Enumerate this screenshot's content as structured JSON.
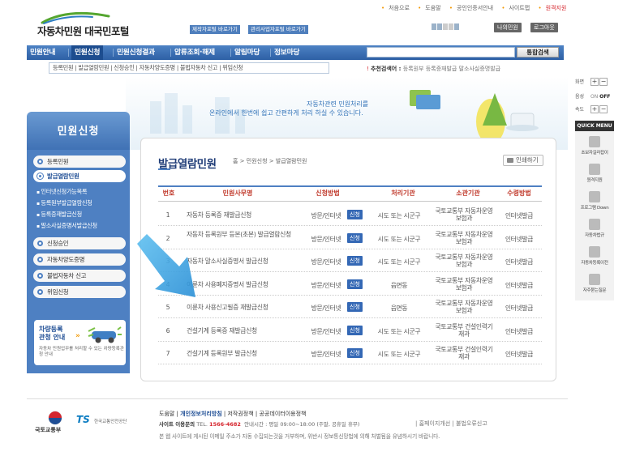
{
  "header": {
    "logo_text": "자동차민원 대국민포털",
    "link_buttons": [
      "제작자포털 바로가기",
      "관리사업자포털 바로가기"
    ],
    "util_links": [
      "처음으로",
      "도움말",
      "공인인증서안내",
      "사이트맵",
      "원격지원"
    ],
    "my_civil_button": "나의민원",
    "logout_button": "로그아웃"
  },
  "nav": {
    "items": [
      "민원안내",
      "민원신청",
      "민원신청결과",
      "압류조회·해제",
      "알림마당",
      "정보마당"
    ],
    "active_index": 1,
    "search_button": "통합검색",
    "search_value": ""
  },
  "subnav": {
    "text": "등록민원 | 발급열람민원 | 신청승인 | 자동차양도증명 | 불법자동차 신고 | 위임신청"
  },
  "recommended": {
    "label": "추천검색어 :",
    "terms": "등록원부  등록증재발급  말소사실증명발급"
  },
  "banner": {
    "line1": "자동차관련 민원처리를",
    "line2": "온라인에서 한번에 쉽고 간편하게 처리 하실 수 있습니다."
  },
  "left_menu": {
    "title": "민원신청",
    "items": [
      {
        "label": "등록민원"
      },
      {
        "label": "발급열람민원",
        "active": true
      },
      {
        "label": "신청승인"
      },
      {
        "label": "자동차양도증명"
      },
      {
        "label": "불법자동차 신고"
      },
      {
        "label": "위임신청"
      }
    ],
    "sub_items": [
      "인터넷신청가능목록",
      "등록원부발급열람신청",
      "등록증재발급신청",
      "말소사실증명서발급신청"
    ],
    "card": {
      "title1": "차량등록",
      "title2": "관청 안내",
      "desc": "자동차 민원업무를 처리할 수 있는 차량등록관청 안내"
    }
  },
  "content": {
    "title": "발급열람민원",
    "breadcrumb": "홈 > 민원신청 > 발급열람민원",
    "print_button": "인쇄하기",
    "table": {
      "headers": [
        "번호",
        "민원사무명",
        "신청방법",
        "처리기관",
        "소관기관",
        "수령방법"
      ],
      "rows": [
        {
          "no": "1",
          "name": "자동차 등록증 재발급신청",
          "method": "방문/인터넷",
          "badge": "신청",
          "proc": "시도 또는 시군구",
          "org": "국토교통부 자동차운영보험과",
          "receive": "인터넷발급"
        },
        {
          "no": "2",
          "name": "자동차 등록원부 등본(초본) 발급열람신청",
          "method": "방문/인터넷",
          "badge": "신청",
          "proc": "시도 또는 시군구",
          "org": "국토교통부 자동차운영보험과",
          "receive": "인터넷발급"
        },
        {
          "no": "3",
          "name": "자동차 말소사실증명서 발급신청",
          "method": "방문/인터넷",
          "badge": "신청",
          "proc": "시도 또는 시군구",
          "org": "국토교통부 자동차운영보험과",
          "receive": "인터넷발급"
        },
        {
          "no": "4",
          "name": "이륜차 사용폐지증명서 발급신청",
          "method": "방문/인터넷",
          "badge": "신청",
          "proc": "읍면동",
          "org": "국토교통부 자동차운영보험과",
          "receive": "인터넷발급"
        },
        {
          "no": "5",
          "name": "이륜차 사용신고필증 재발급신청",
          "method": "방문/인터넷",
          "badge": "신청",
          "proc": "읍면동",
          "org": "국토교통부 자동차운영보험과",
          "receive": "인터넷발급"
        },
        {
          "no": "6",
          "name": "건설기계 등록증 재발급신청",
          "method": "방문/인터넷",
          "badge": "신청",
          "proc": "시도 또는 시군구",
          "org": "국토교통부 건설인력기재과",
          "receive": "인터넷발급"
        },
        {
          "no": "7",
          "name": "건설기계 등록원부 발급신청",
          "method": "방문/인터넷",
          "badge": "신청",
          "proc": "시도 또는 시군구",
          "org": "국토교통부 건설인력기재과",
          "receive": "인터넷발급"
        }
      ]
    },
    "overlay_icon": "big-blue-arrow-icon"
  },
  "right_side": {
    "zoom_in_label": "화면",
    "sound_label": "음성",
    "sound_on": "ON",
    "sound_off": "OFF",
    "speed_label": "속도",
    "quick_menu_title": "QUICK MENU",
    "quick_items": [
      "초보자길라잡이",
      "원격지원",
      "프로그램 Down",
      "자동차법규",
      "자동차등록이전",
      "자주묻는질문"
    ]
  },
  "footer": {
    "links": [
      "도움말",
      "개인정보처리방침",
      "저작권정책",
      "공공데이터이용정책"
    ],
    "org_name": "사이트 이용문의",
    "tel_label": "TEL.",
    "tel": "1566-4682",
    "hours": "안내시간 : 평일 09:00~18:00 (주말, 공휴일 휴무)",
    "notice": "본 웹 사이트에 게시된 이메일 주소가 자동 수집되는것을 거부하며, 위반시 정보통신망법에 의해 처벌됨을 유념하시기 바랍니다.",
    "right_links": "| 홈페이지개선 | 불법오류신고",
    "logo1_text": "국토교통부",
    "logo2_text": "TS",
    "logo2_sub": "한국교통안전공단"
  }
}
